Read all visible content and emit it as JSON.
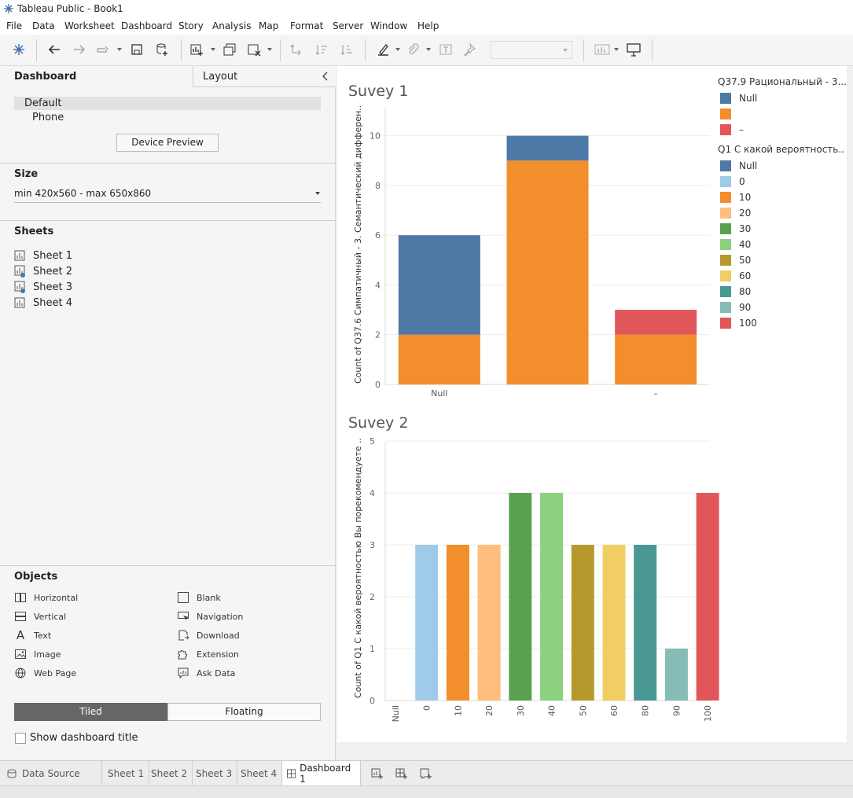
{
  "window": {
    "title": "Tableau Public - Book1"
  },
  "menu": [
    "File",
    "Data",
    "Worksheet",
    "Dashboard",
    "Story",
    "Analysis",
    "Map",
    "Format",
    "Server",
    "Window",
    "Help"
  ],
  "left_pane": {
    "tab_dashboard": "Dashboard",
    "tab_layout": "Layout",
    "devices": [
      "Default",
      "Phone"
    ],
    "device_preview_label": "Device Preview",
    "size_header": "Size",
    "size_value": "min 420x560 - max 650x860",
    "sheets_header": "Sheets",
    "sheets": [
      "Sheet 1",
      "Sheet 2",
      "Sheet 3",
      "Sheet 4"
    ],
    "objects_header": "Objects",
    "objects_left": [
      "Horizontal",
      "Vertical",
      "Text",
      "Image",
      "Web Page"
    ],
    "objects_right": [
      "Blank",
      "Navigation",
      "Download",
      "Extension",
      "Ask Data"
    ],
    "tiled_label": "Tiled",
    "floating_label": "Floating",
    "show_title_label": "Show dashboard title"
  },
  "legends": {
    "legend1_title": "Q37.9 Рациональный - 3...",
    "legend1_items": [
      {
        "label": "Null",
        "color": "#4e79a7"
      },
      {
        "label": "",
        "color": "#f28e2b"
      },
      {
        "label": "–",
        "color": "#e15759"
      }
    ],
    "legend2_title": "Q1 С какой вероятность..",
    "legend2_items": [
      {
        "label": "Null",
        "color": "#4e79a7"
      },
      {
        "label": "0",
        "color": "#a0cbe8"
      },
      {
        "label": "10",
        "color": "#f28e2b"
      },
      {
        "label": "20",
        "color": "#ffbe7d"
      },
      {
        "label": "30",
        "color": "#59a14f"
      },
      {
        "label": "40",
        "color": "#8cd17d"
      },
      {
        "label": "50",
        "color": "#b6992d"
      },
      {
        "label": "60",
        "color": "#f1ce63"
      },
      {
        "label": "80",
        "color": "#499894"
      },
      {
        "label": "90",
        "color": "#86bcb6"
      },
      {
        "label": "100",
        "color": "#e15759"
      }
    ]
  },
  "tabs": {
    "data_source": "Data Source",
    "sheets": [
      "Sheet 1",
      "Sheet 2",
      "Sheet 3",
      "Sheet 4"
    ],
    "dashboard": "Dashboard 1"
  },
  "chart_data": [
    {
      "type": "bar",
      "stacked": true,
      "title": "Suvey 1",
      "xlabel": "",
      "ylabel": "Count of Q37.6 Симпатичный - 3. Семантический дифферен..",
      "categories": [
        "Null",
        "",
        "–"
      ],
      "series": [
        {
          "name": "",
          "color": "#f28e2b",
          "values": [
            2,
            9,
            2
          ]
        },
        {
          "name": "–",
          "color": "#e15759",
          "values": [
            0,
            0,
            1
          ]
        },
        {
          "name": "Null",
          "color": "#4e79a7",
          "values": [
            4,
            1,
            0
          ]
        }
      ],
      "ylim": [
        0,
        11
      ],
      "yticks": [
        0,
        2,
        4,
        6,
        8,
        10
      ],
      "grid": true
    },
    {
      "type": "bar",
      "title": "Suvey 2",
      "xlabel": "",
      "ylabel": "Count of Q1 С какой вероятностью Вы порекомендуете ..",
      "categories": [
        "Null",
        "0",
        "10",
        "20",
        "30",
        "40",
        "50",
        "60",
        "80",
        "90",
        "100"
      ],
      "values": [
        0,
        3,
        3,
        3,
        4,
        4,
        3,
        3,
        3,
        1,
        4
      ],
      "colors": [
        "#4e79a7",
        "#a0cbe8",
        "#f28e2b",
        "#ffbe7d",
        "#59a14f",
        "#8cd17d",
        "#b6992d",
        "#f1ce63",
        "#499894",
        "#86bcb6",
        "#e15759"
      ],
      "ylim": [
        0,
        5.2
      ],
      "yticks": [
        0,
        1,
        2,
        3,
        4,
        5
      ],
      "grid": true
    }
  ]
}
